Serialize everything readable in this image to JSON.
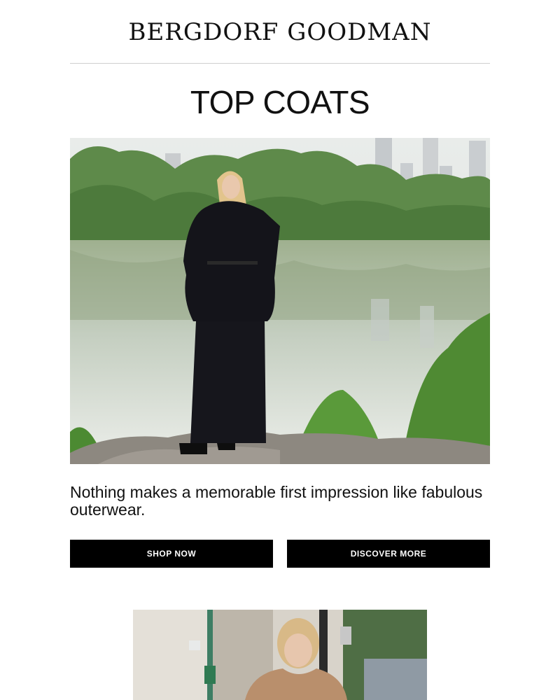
{
  "header": {
    "logo_text": "BERGDORF GOODMAN"
  },
  "hero": {
    "headline": "TOP COATS",
    "image_alt": "Model in black belted coat and long skirt standing by a lake in Central Park",
    "tagline": "Nothing makes a memorable first impression like fabulous outerwear."
  },
  "buttons": {
    "shop_now": "SHOP NOW",
    "discover_more": "DISCOVER MORE"
  },
  "second_image": {
    "image_alt": "Model in camel teddy coat on a city street"
  },
  "colors": {
    "button_bg": "#000000",
    "button_text": "#ffffff",
    "divider": "#cfcfcf"
  }
}
